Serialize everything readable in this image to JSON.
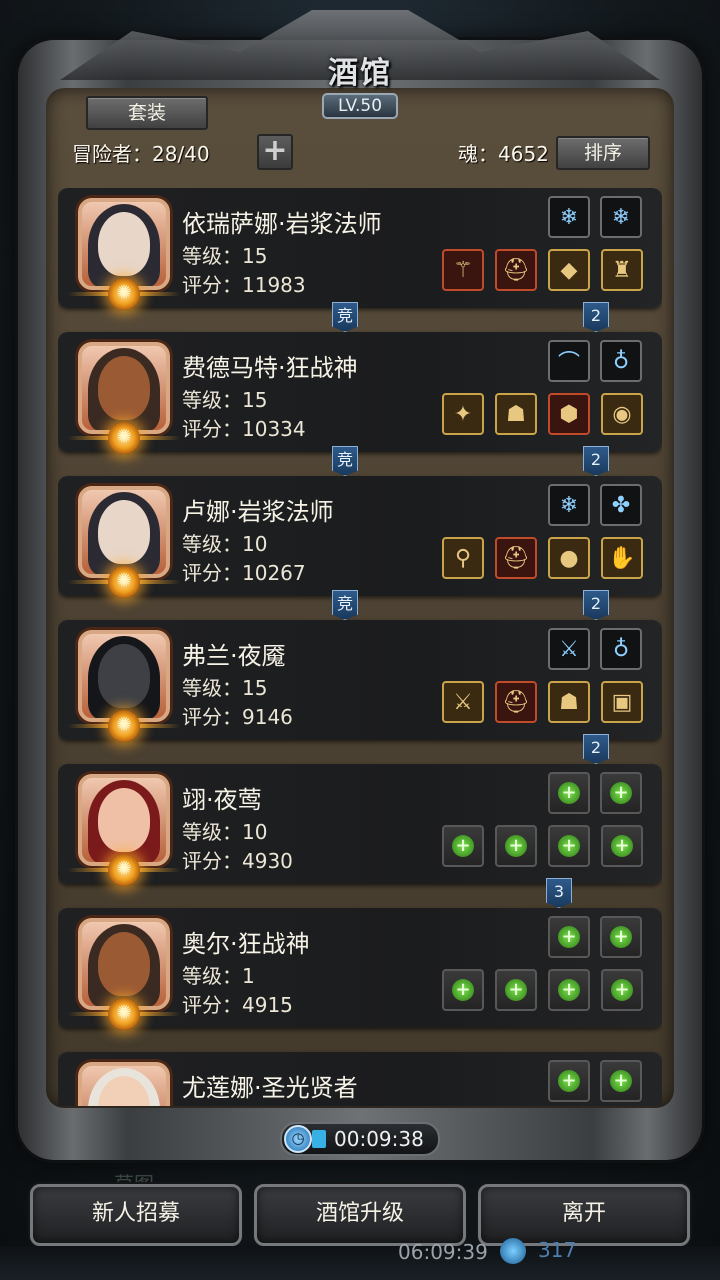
{
  "title": "酒馆",
  "level_badge": "LV.50",
  "suit_button": "套装",
  "adventurers": {
    "label": "冒险者：28/40",
    "add_symbol": "+"
  },
  "soul": {
    "label": "魂：4652"
  },
  "sort_button": "排序",
  "heroes": [
    {
      "name": "依瑞萨娜·岩浆法师",
      "level": "等级：15",
      "score": "评分：11983",
      "rank_tag": "竞",
      "slot_tag": "2",
      "gear_top": [
        "ice-rune-icon",
        "ice-rune-icon"
      ],
      "gear_bottom": [
        "staff-icon",
        "helmet-icon",
        "emerald-icon",
        "lantern-icon"
      ]
    },
    {
      "name": "费德马特·狂战神",
      "level": "等级：15",
      "score": "评分：10334",
      "rank_tag": "竞",
      "slot_tag": "2",
      "gear_top": [
        "bow-icon",
        "amulet-icon"
      ],
      "gear_bottom": [
        "mace-icon",
        "armor-icon",
        "shield-icon",
        "ring-icon"
      ]
    },
    {
      "name": "卢娜·岩浆法师",
      "level": "等级：10",
      "score": "评分：10267",
      "rank_tag": "竞",
      "slot_tag": "2",
      "gear_top": [
        "ice-rune-icon",
        "nature-rune-icon"
      ],
      "gear_bottom": [
        "wand-icon",
        "helmet-icon",
        "orb-icon",
        "gauntlet-icon"
      ]
    },
    {
      "name": "弗兰·夜魇",
      "level": "等级：15",
      "score": "评分：9146",
      "rank_tag": "",
      "slot_tag": "2",
      "gear_top": [
        "dagger-icon",
        "amulet-icon"
      ],
      "gear_bottom": [
        "sword-icon",
        "helmet-icon",
        "mask-icon",
        "scroll-icon"
      ]
    },
    {
      "name": "翊·夜莺",
      "level": "等级：10",
      "score": "评分：4930",
      "rank_tag": "",
      "slot_tag": "3",
      "gear_top": [
        "empty-slot",
        "empty-slot"
      ],
      "gear_bottom": [
        "empty-slot",
        "empty-slot",
        "empty-slot",
        "empty-slot"
      ]
    },
    {
      "name": "奥尔·狂战神",
      "level": "等级：1",
      "score": "评分：4915",
      "rank_tag": "",
      "slot_tag": "",
      "gear_top": [
        "empty-slot",
        "empty-slot"
      ],
      "gear_bottom": [
        "empty-slot",
        "empty-slot",
        "empty-slot",
        "empty-slot"
      ]
    },
    {
      "name": "尤莲娜·圣光贤者",
      "level": "",
      "score": "",
      "rank_tag": "",
      "slot_tag": "",
      "gear_top": [
        "empty-slot",
        "empty-slot"
      ],
      "gear_bottom": []
    }
  ],
  "timer": "00:09:38",
  "buttons": {
    "recruit": "新人招募",
    "upgrade": "酒馆升级",
    "leave": "离开"
  },
  "background": {
    "clock": "06:09:39",
    "count": "317",
    "behind_label": "草图"
  },
  "colors": {
    "panel": "#524737",
    "card": "#1f2022",
    "tag": "#2e5a8a",
    "accent_gold": "#ffb030",
    "empty_plus": "#7ae04a"
  }
}
